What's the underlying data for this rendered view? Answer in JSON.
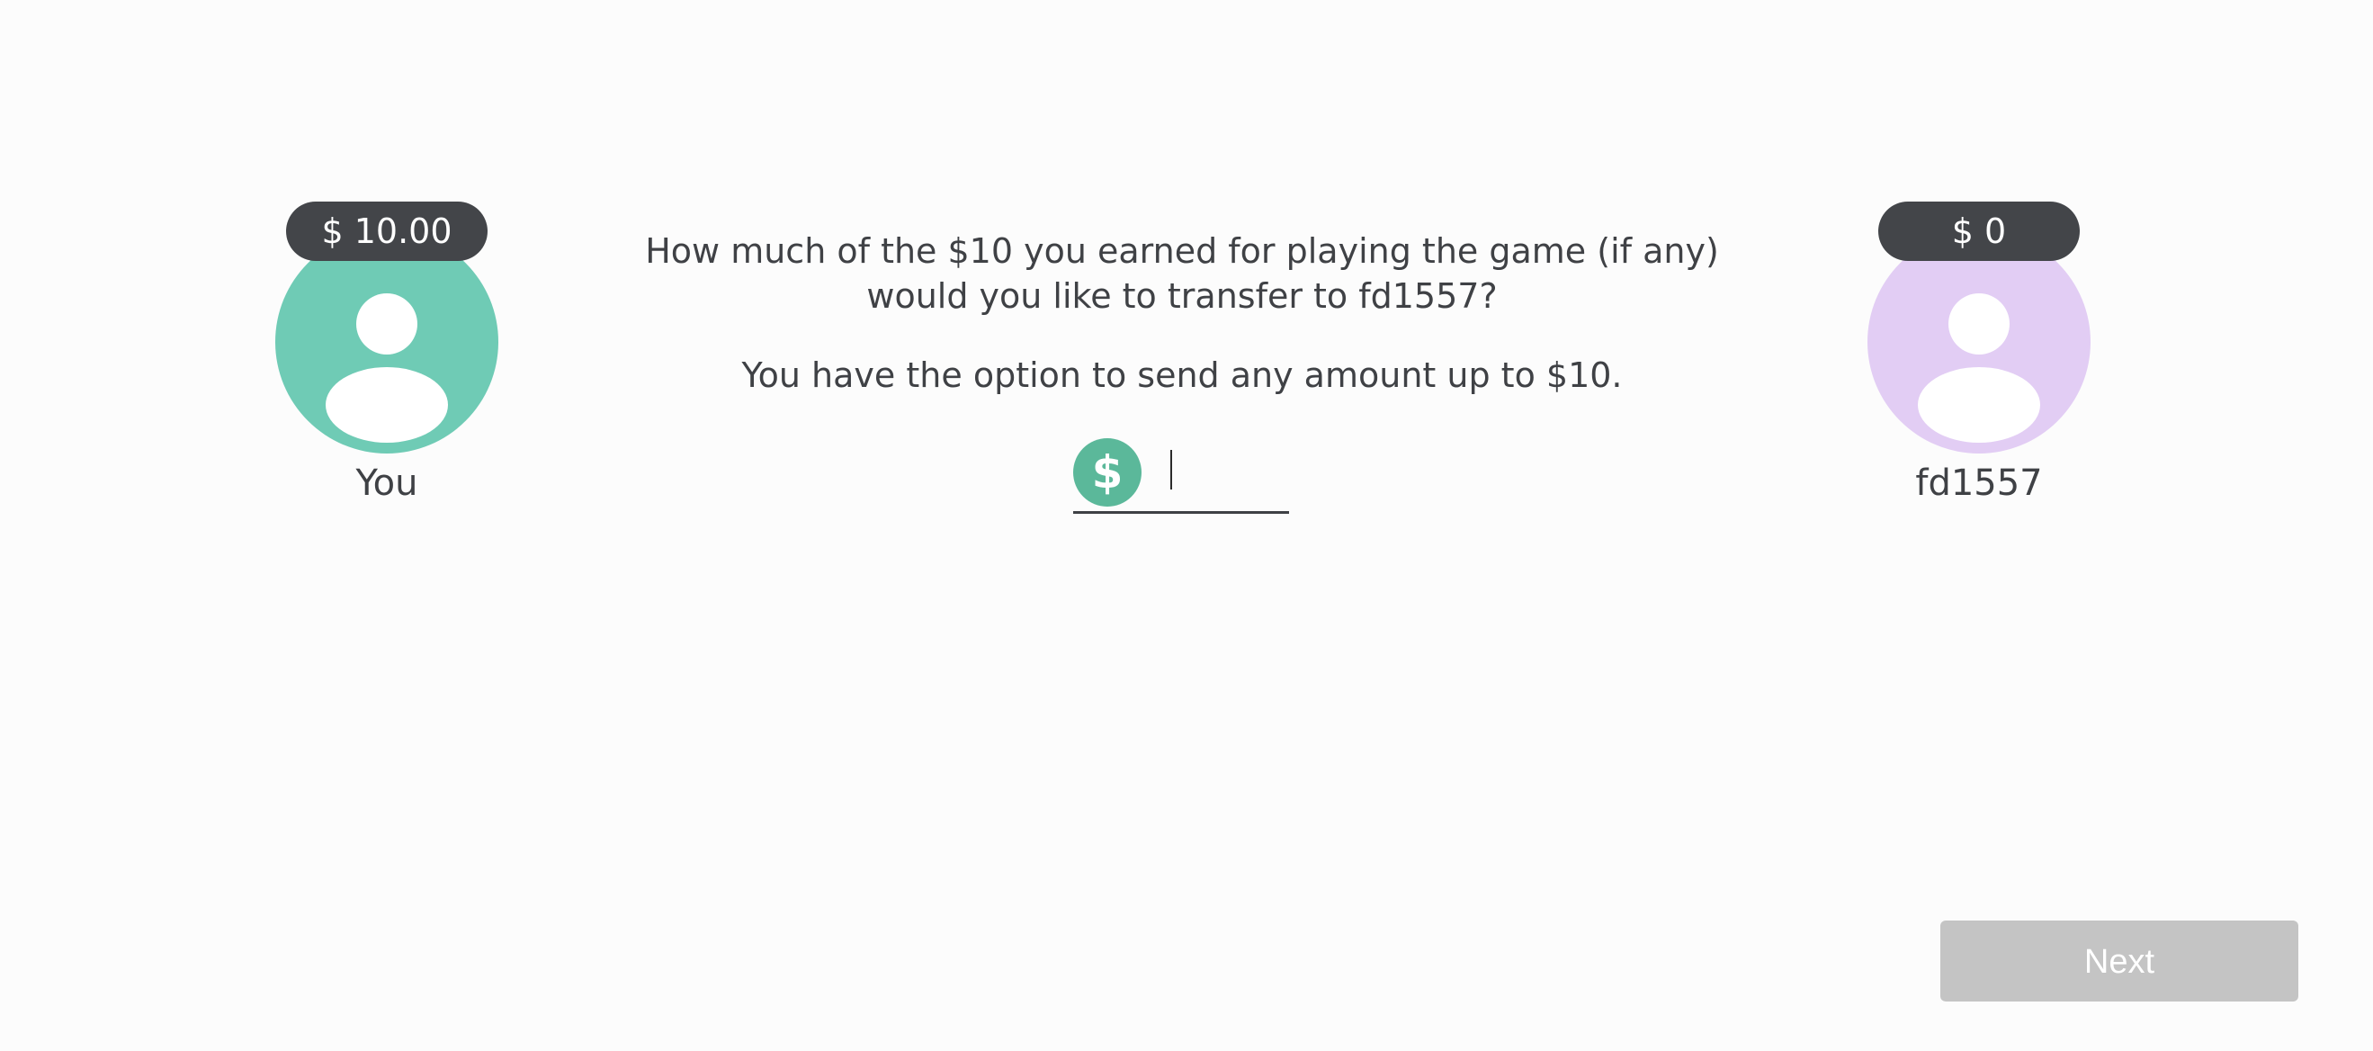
{
  "players": {
    "you": {
      "balance": "$ 10.00",
      "name": "You",
      "avatar_color": "#6fcbb5"
    },
    "other": {
      "balance": "$ 0",
      "name": "fd1557",
      "avatar_color": "#e2cdf4"
    }
  },
  "prompt": {
    "question_line1": "How much of the $10 you earned for playing the game (if any)",
    "question_line2": "would you like to transfer to fd1557?",
    "option_text": "You have the option to send any amount up to $10."
  },
  "amount_input": {
    "icon": "dollar-icon",
    "icon_glyph": "$",
    "value": "",
    "icon_color": "#5bb89a"
  },
  "next_button": {
    "label": "Next",
    "state": "disabled"
  }
}
